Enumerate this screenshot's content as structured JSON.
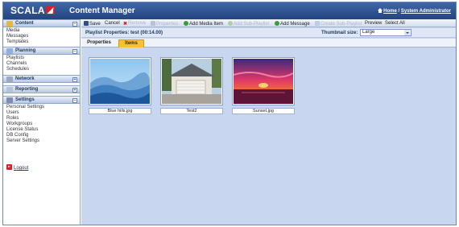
{
  "header": {
    "logo": "SCALA",
    "product": "Content Manager",
    "home_link": "Home",
    "separator": "/",
    "user_link": "System Administrator"
  },
  "sidebar": {
    "sections": [
      {
        "label": "Content",
        "items": [
          "Media",
          "Messages",
          "Templates"
        ]
      },
      {
        "label": "Planning",
        "items": [
          "Playlists",
          "Channels",
          "Schedules"
        ]
      },
      {
        "label": "Network",
        "items": []
      },
      {
        "label": "Reporting",
        "items": []
      },
      {
        "label": "Settings",
        "items": [
          "Personal Settings",
          "Users",
          "Roles",
          "Workgroups",
          "License Status",
          "DB Config",
          "Server Settings"
        ]
      }
    ],
    "logout": "Logout"
  },
  "toolbar": {
    "save": "Save",
    "cancel": "Cancel",
    "remove": "Remove",
    "properties": "Properties",
    "add_media": "Add Media Item",
    "add_subplaylist": "Add Sub-Playlist",
    "add_message": "Add Message",
    "create_subplaylist": "Create Sub-Playlist",
    "preview": "Preview",
    "select_all": "Select All"
  },
  "playlist": {
    "title": "Playlist Properties: test (00:14.00)",
    "thumbnail_label": "Thumbnail size:",
    "thumbnail_value": "Large"
  },
  "tabs": {
    "properties": "Properties",
    "items": "Items"
  },
  "items": [
    {
      "caption": "Blue hills.jpg"
    },
    {
      "caption": "Test2"
    },
    {
      "caption": "Sunset.jpg"
    }
  ],
  "colors": {
    "header": "#23457f",
    "accent_tab": "#f7c232",
    "content_bg": "#c8d7ef",
    "brand_red": "#d8202a"
  }
}
